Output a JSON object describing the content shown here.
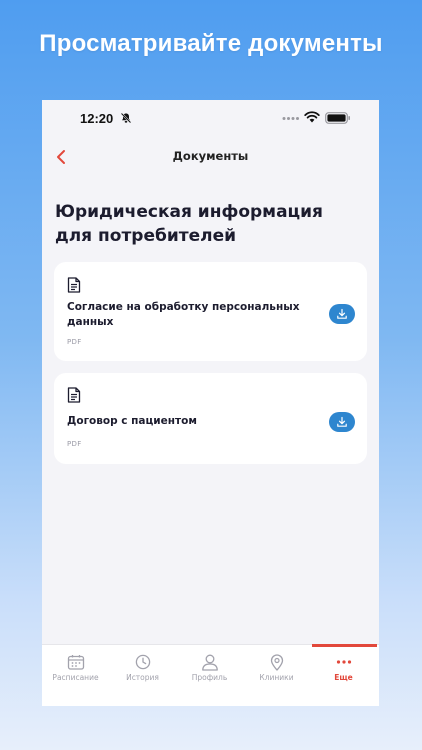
{
  "promo": {
    "headline": "Просматривайте документы"
  },
  "status_bar": {
    "time": "12:20"
  },
  "nav": {
    "title": "Документы"
  },
  "page": {
    "title": "Юридическая информация для потребителей"
  },
  "documents": [
    {
      "title": "Согласие на обработку персональных данных",
      "type": "PDF"
    },
    {
      "title": "Договор с пациентом",
      "type": "PDF"
    }
  ],
  "tabs": [
    {
      "label": "Расписание",
      "icon": "calendar-icon"
    },
    {
      "label": "История",
      "icon": "clock-icon"
    },
    {
      "label": "Профиль",
      "icon": "person-icon"
    },
    {
      "label": "Клиники",
      "icon": "location-pin-icon"
    },
    {
      "label": "Еще",
      "icon": "more-dots-icon",
      "active": true
    }
  ],
  "colors": {
    "accent": "#e2483b",
    "download_button": "#2e86cf",
    "background_top": "#4f9df0",
    "screen_background": "#f4f4f8"
  }
}
